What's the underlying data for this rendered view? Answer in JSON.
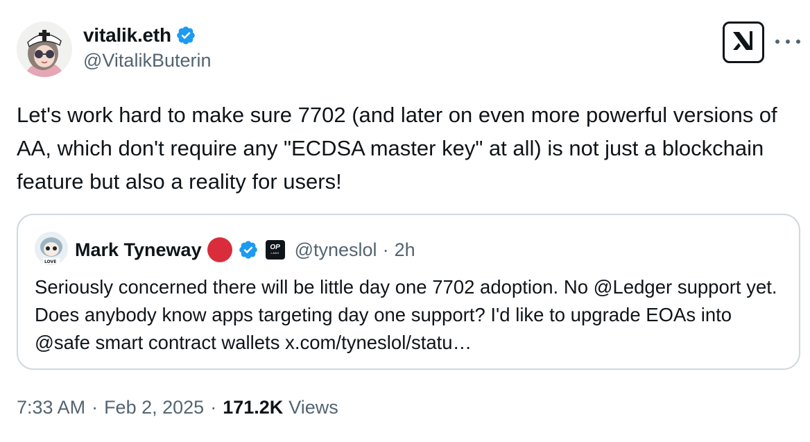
{
  "author": {
    "display_name": "vitalik.eth",
    "handle": "@VitalikButerin",
    "verified": true
  },
  "tweet": {
    "text": "Let's work hard to make sure 7702 (and later on even more powerful versions of AA, which don't require any \"ECDSA master key\" at all) is not just a blockchain feature but also a reality for users!"
  },
  "quoted": {
    "display_name": "Mark Tyneway",
    "handle": "@tyneslol",
    "separator": "·",
    "time": "2h",
    "badge_top": "OP",
    "badge_bottom": "LABS",
    "text": "Seriously concerned there will be little day one 7702 adoption. No @Ledger support yet. Does anybody know apps targeting day one support? I'd like to upgrade EOAs into @safe smart contract wallets x.com/tyneslol/statu…"
  },
  "meta": {
    "time": "7:33 AM",
    "sep1": "·",
    "date": "Feb 2, 2025",
    "sep2": "·",
    "views_count": "171.2K",
    "views_label": "Views"
  },
  "icons": {
    "grok": "grok-icon",
    "more": "more-icon",
    "verified": "verified-badge-icon"
  },
  "colors": {
    "text": "#0f1419",
    "secondary": "#536471",
    "verified_blue": "#1d9bf0",
    "red_dot": "#d92d3c",
    "border": "#cfd9de"
  }
}
